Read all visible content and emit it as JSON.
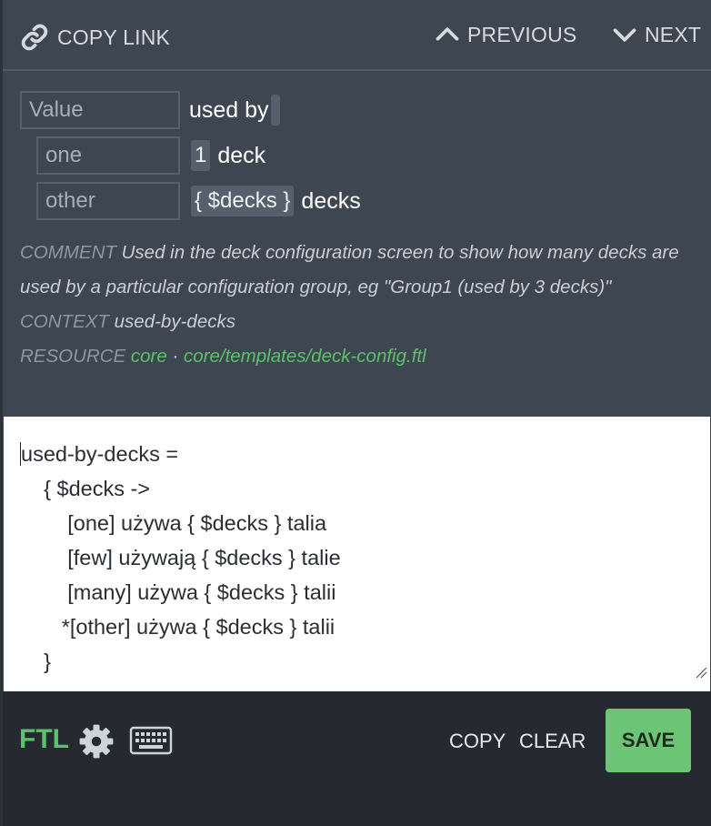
{
  "nav": {
    "copy_link": "COPY LINK",
    "previous": "PREVIOUS",
    "next": "NEXT"
  },
  "source": {
    "selector_label": "Value",
    "selector_text": "used by",
    "variants": [
      {
        "key": "one",
        "placeable": "1",
        "text": "deck"
      },
      {
        "key": "other",
        "placeable": "{ $decks }",
        "text": "decks"
      }
    ]
  },
  "meta": {
    "comment_label": "COMMENT",
    "comment": "Used in the deck configuration screen to show how many decks are used by a particular configuration group, eg \"Group1 (used by 3 decks)\"",
    "context_label": "CONTEXT",
    "context": "used-by-decks",
    "resource_label": "RESOURCE",
    "resource_project": "core",
    "resource_separator": "·",
    "resource_path": "core/templates/deck-config.ftl"
  },
  "editor": {
    "lines": [
      "used-by-decks =",
      "    { $decks ->",
      "        [one] używa { $decks } talia",
      "        [few] używają { $decks } talie",
      "        [many] używa { $decks } talii",
      "       *[other] używa { $decks } talii",
      "    }"
    ]
  },
  "toolbar": {
    "syntax": "FTL",
    "settings_icon": "gear-icon",
    "keyboard_icon": "keyboard-icon",
    "copy": "COPY",
    "clear": "CLEAR",
    "save": "SAVE"
  },
  "colors": {
    "accent": "#5ac26a",
    "save_bg": "#6cc574",
    "panel_bg": "#3e4651",
    "toolbar_bg": "#262a30"
  }
}
